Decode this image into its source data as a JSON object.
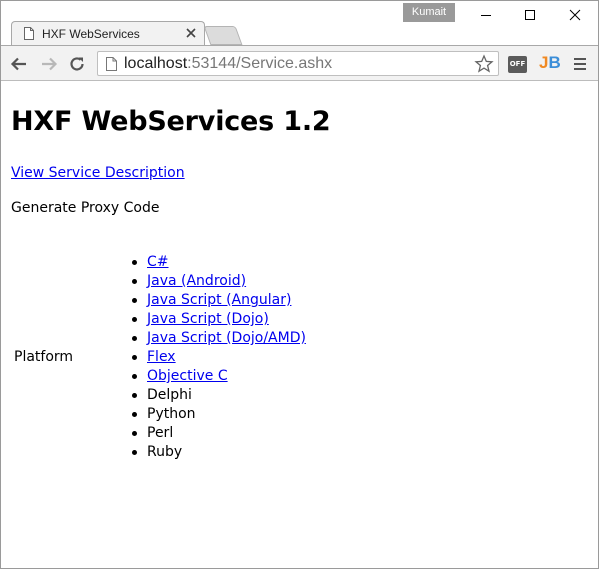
{
  "browser": {
    "tab_title": "HXF WebServices",
    "profile_name": "Kumait",
    "url_host": "localhost",
    "url_rest": ":53144/Service.ashx",
    "extensions": {
      "off_badge": "OFF",
      "jb_j": "J",
      "jb_b": "B"
    }
  },
  "page": {
    "heading": "HXF WebServices 1.2",
    "description_link": "View Service Description",
    "generate_label": "Generate Proxy Code",
    "platform_label": "Platform",
    "platforms": [
      {
        "label": "C#",
        "link": true
      },
      {
        "label": "Java (Android)",
        "link": true
      },
      {
        "label": "Java Script (Angular)",
        "link": true
      },
      {
        "label": "Java Script (Dojo)",
        "link": true
      },
      {
        "label": "Java Script (Dojo/AMD)",
        "link": true
      },
      {
        "label": "Flex",
        "link": true
      },
      {
        "label": "Objective C",
        "link": true
      },
      {
        "label": "Delphi",
        "link": false
      },
      {
        "label": "Python",
        "link": false
      },
      {
        "label": "Perl",
        "link": false
      },
      {
        "label": "Ruby",
        "link": false
      }
    ]
  },
  "colors": {
    "link": "#0000ee",
    "profile_badge": "#9a9a9a",
    "toolbar_bg": "#f2f2f2",
    "jb_orange": "#f08a24",
    "jb_blue": "#3c8ed8"
  }
}
